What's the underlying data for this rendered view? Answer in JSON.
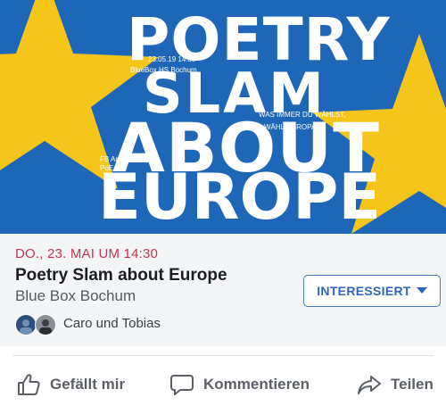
{
  "poster": {
    "colors": {
      "blue": "#1d66b8",
      "yellow": "#f6c51a",
      "text": "#ffffff"
    },
    "lines": [
      "POETRY",
      "SLAM",
      "ABOUT",
      "EUROPE"
    ],
    "date_time": "23.05.19 14:30",
    "venue": "BlueBox HS Bochum",
    "slogan_1": "WAS IMMER DU WÄHLST,",
    "slogan_2": "WÄHL EUROPA.",
    "credit_1": "FB Architektur  mit",
    "credit_2": "PoE BO"
  },
  "event": {
    "date": "DO., 23. MAI UM 14:30",
    "title": "Poetry Slam about Europe",
    "location": "Blue Box Bochum",
    "interested_label": "INTERESSIERT",
    "friends_text": "Caro und Tobias",
    "accent_color": "#c0374d"
  },
  "actions": {
    "like": {
      "label": "Gefällt mir",
      "icon": "thumbs-up-icon"
    },
    "comment": {
      "label": "Kommentieren",
      "icon": "comment-icon"
    },
    "share": {
      "label": "Teilen",
      "icon": "share-icon"
    }
  }
}
